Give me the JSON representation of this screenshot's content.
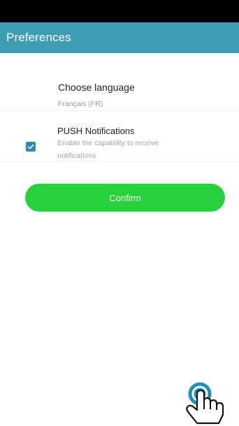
{
  "app_bar": {
    "title": "Preferences"
  },
  "language": {
    "title": "Choose language",
    "value": "Français (FR)"
  },
  "push": {
    "title": "PUSH Notifications",
    "description": "Enable the capability to receive notifications",
    "checked": true
  },
  "confirm_button": {
    "label": "Confirm"
  },
  "colors": {
    "app_bar": "#3d9db3",
    "confirm": "#25d239",
    "checkbox": "#2a8bb3",
    "tap_ring": "#1f8fc0"
  },
  "icons": {
    "checkbox": "check-icon",
    "cursor": "tap-hand-icon"
  }
}
